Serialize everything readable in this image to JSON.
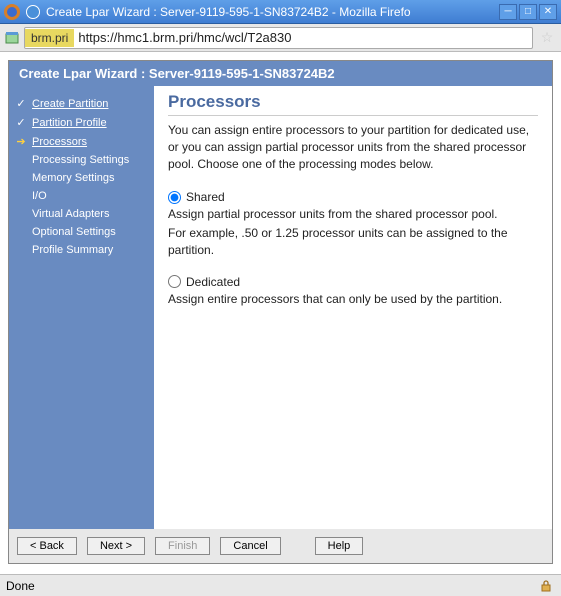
{
  "window": {
    "title": "Create Lpar Wizard : Server-9119-595-1-SN83724B2 - Mozilla Firefo"
  },
  "url": {
    "host": "brm.pri",
    "path": "https://hmc1.brm.pri/hmc/wcl/T2a830"
  },
  "wizard": {
    "header": "Create Lpar Wizard : Server-9119-595-1-SN83724B2",
    "steps": {
      "create_partition": "Create Partition",
      "partition_profile": "Partition Profile",
      "processors": "Processors",
      "processing_settings": "Processing Settings",
      "memory_settings": "Memory Settings",
      "io": "I/O",
      "virtual_adapters": "Virtual Adapters",
      "optional_settings": "Optional Settings",
      "profile_summary": "Profile Summary"
    }
  },
  "main": {
    "title": "Processors",
    "description": "You can assign entire processors to your partition for dedicated use, or you can assign partial processor units from the shared processor pool. Choose one of the processing modes below.",
    "shared": {
      "label": "Shared",
      "desc1": "Assign partial processor units from the shared processor pool.",
      "desc2": "For example, .50 or 1.25 processor units can be assigned to the partition."
    },
    "dedicated": {
      "label": "Dedicated",
      "desc": "Assign entire processors that can only be used by the partition."
    }
  },
  "buttons": {
    "back": "< Back",
    "next": "Next >",
    "finish": "Finish",
    "cancel": "Cancel",
    "help": "Help"
  },
  "status": {
    "text": "Done"
  }
}
